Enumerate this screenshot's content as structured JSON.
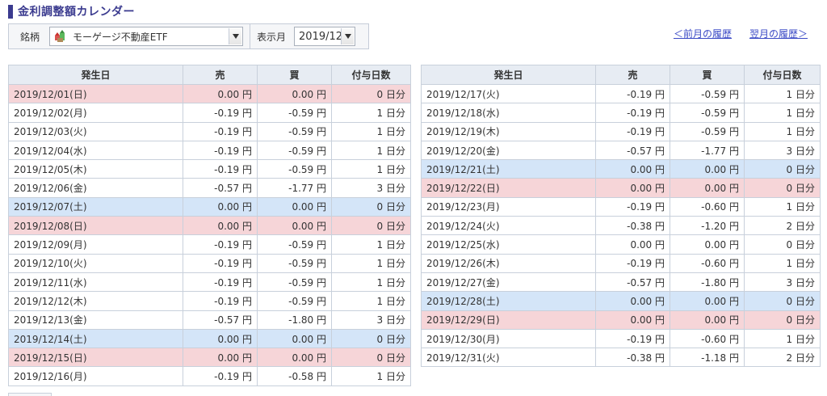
{
  "page": {
    "title": "金利調整額カレンダー"
  },
  "filters": {
    "stock_label": "銘柄",
    "stock_value": "モーゲージ不動産ETF",
    "month_label": "表示月",
    "month_value": "2019/12"
  },
  "nav": {
    "prev": "＜前月の履歴",
    "next": "翌月の履歴＞"
  },
  "table": {
    "headers": [
      "発生日",
      "売",
      "買",
      "付与日数"
    ],
    "left_rows": [
      {
        "date": "2019/12/01(日)",
        "sell": "0.00 円",
        "buy": "0.00 円",
        "days": "0 日分",
        "type": "sun"
      },
      {
        "date": "2019/12/02(月)",
        "sell": "-0.19 円",
        "buy": "-0.59 円",
        "days": "1 日分",
        "type": "weekday"
      },
      {
        "date": "2019/12/03(火)",
        "sell": "-0.19 円",
        "buy": "-0.59 円",
        "days": "1 日分",
        "type": "weekday"
      },
      {
        "date": "2019/12/04(水)",
        "sell": "-0.19 円",
        "buy": "-0.59 円",
        "days": "1 日分",
        "type": "weekday"
      },
      {
        "date": "2019/12/05(木)",
        "sell": "-0.19 円",
        "buy": "-0.59 円",
        "days": "1 日分",
        "type": "weekday"
      },
      {
        "date": "2019/12/06(金)",
        "sell": "-0.57 円",
        "buy": "-1.77 円",
        "days": "3 日分",
        "type": "weekday"
      },
      {
        "date": "2019/12/07(土)",
        "sell": "0.00 円",
        "buy": "0.00 円",
        "days": "0 日分",
        "type": "sat"
      },
      {
        "date": "2019/12/08(日)",
        "sell": "0.00 円",
        "buy": "0.00 円",
        "days": "0 日分",
        "type": "sun"
      },
      {
        "date": "2019/12/09(月)",
        "sell": "-0.19 円",
        "buy": "-0.59 円",
        "days": "1 日分",
        "type": "weekday"
      },
      {
        "date": "2019/12/10(火)",
        "sell": "-0.19 円",
        "buy": "-0.59 円",
        "days": "1 日分",
        "type": "weekday"
      },
      {
        "date": "2019/12/11(水)",
        "sell": "-0.19 円",
        "buy": "-0.59 円",
        "days": "1 日分",
        "type": "weekday"
      },
      {
        "date": "2019/12/12(木)",
        "sell": "-0.19 円",
        "buy": "-0.59 円",
        "days": "1 日分",
        "type": "weekday"
      },
      {
        "date": "2019/12/13(金)",
        "sell": "-0.57 円",
        "buy": "-1.80 円",
        "days": "3 日分",
        "type": "weekday"
      },
      {
        "date": "2019/12/14(土)",
        "sell": "0.00 円",
        "buy": "0.00 円",
        "days": "0 日分",
        "type": "sat"
      },
      {
        "date": "2019/12/15(日)",
        "sell": "0.00 円",
        "buy": "0.00 円",
        "days": "0 日分",
        "type": "sun"
      },
      {
        "date": "2019/12/16(月)",
        "sell": "-0.19 円",
        "buy": "-0.58 円",
        "days": "1 日分",
        "type": "weekday"
      }
    ],
    "right_rows": [
      {
        "date": "2019/12/17(火)",
        "sell": "-0.19 円",
        "buy": "-0.59 円",
        "days": "1 日分",
        "type": "weekday"
      },
      {
        "date": "2019/12/18(水)",
        "sell": "-0.19 円",
        "buy": "-0.59 円",
        "days": "1 日分",
        "type": "weekday"
      },
      {
        "date": "2019/12/19(木)",
        "sell": "-0.19 円",
        "buy": "-0.59 円",
        "days": "1 日分",
        "type": "weekday"
      },
      {
        "date": "2019/12/20(金)",
        "sell": "-0.57 円",
        "buy": "-1.77 円",
        "days": "3 日分",
        "type": "weekday"
      },
      {
        "date": "2019/12/21(土)",
        "sell": "0.00 円",
        "buy": "0.00 円",
        "days": "0 日分",
        "type": "sat"
      },
      {
        "date": "2019/12/22(日)",
        "sell": "0.00 円",
        "buy": "0.00 円",
        "days": "0 日分",
        "type": "sun"
      },
      {
        "date": "2019/12/23(月)",
        "sell": "-0.19 円",
        "buy": "-0.60 円",
        "days": "1 日分",
        "type": "weekday"
      },
      {
        "date": "2019/12/24(火)",
        "sell": "-0.38 円",
        "buy": "-1.20 円",
        "days": "2 日分",
        "type": "weekday"
      },
      {
        "date": "2019/12/25(水)",
        "sell": "0.00 円",
        "buy": "0.00 円",
        "days": "0 日分",
        "type": "weekday"
      },
      {
        "date": "2019/12/26(木)",
        "sell": "-0.19 円",
        "buy": "-0.60 円",
        "days": "1 日分",
        "type": "weekday"
      },
      {
        "date": "2019/12/27(金)",
        "sell": "-0.57 円",
        "buy": "-1.80 円",
        "days": "3 日分",
        "type": "weekday"
      },
      {
        "date": "2019/12/28(土)",
        "sell": "0.00 円",
        "buy": "0.00 円",
        "days": "0 日分",
        "type": "sat"
      },
      {
        "date": "2019/12/29(日)",
        "sell": "0.00 円",
        "buy": "0.00 円",
        "days": "0 日分",
        "type": "sun"
      },
      {
        "date": "2019/12/30(月)",
        "sell": "-0.19 円",
        "buy": "-0.60 円",
        "days": "1 日分",
        "type": "weekday"
      },
      {
        "date": "2019/12/31(火)",
        "sell": "-0.38 円",
        "buy": "-1.18 円",
        "days": "2 日分",
        "type": "weekday"
      }
    ]
  },
  "colors": {
    "title": "#3b3b8f",
    "saturday_row": "#d4e5f8",
    "sunday_row": "#f6d5d8",
    "header_bg": "#e7ecf3",
    "link": "#3b4ac6"
  },
  "icons": {
    "stock": "etf-stock-icon",
    "dropdown": "chevron-down-icon"
  }
}
